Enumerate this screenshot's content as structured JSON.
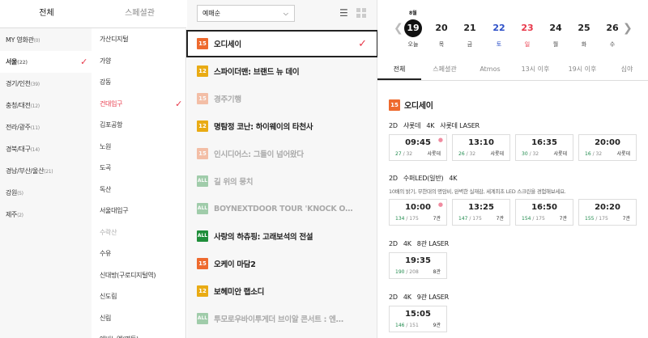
{
  "region_tabs": [
    "전체",
    "스페셜관"
  ],
  "regions": [
    {
      "name": "MY 영화관",
      "count": "(0)"
    },
    {
      "name": "서울",
      "count": "(22)"
    },
    {
      "name": "경기/인천",
      "count": "(39)"
    },
    {
      "name": "충청/대전",
      "count": "(12)"
    },
    {
      "name": "전라/광주",
      "count": "(11)"
    },
    {
      "name": "경북/대구",
      "count": "(14)"
    },
    {
      "name": "경남/부산/울산",
      "count": "(21)"
    },
    {
      "name": "강원",
      "count": "(5)"
    },
    {
      "name": "제주",
      "count": "(2)"
    }
  ],
  "theaters": [
    "가산디지털",
    "가양",
    "강동",
    "건대입구",
    "김포공항",
    "노원",
    "도곡",
    "독산",
    "서울대입구",
    "수락산",
    "수유",
    "신대방(구로디지털역)",
    "신도림",
    "신림",
    "에비뉴엘(명동)"
  ],
  "sort": {
    "label": "예매순",
    "arrow": "⌵"
  },
  "view_icons": {
    "list": "list-view-icon",
    "grid": "grid-view-icon"
  },
  "movies": [
    {
      "rating": "15",
      "title": "오디세이"
    },
    {
      "rating": "12",
      "title": "스파이더맨: 브랜드 뉴 데이"
    },
    {
      "rating": "15",
      "title": "경주기행"
    },
    {
      "rating": "12",
      "title": "명탐정 코난: 하이웨이의 타천사"
    },
    {
      "rating": "15",
      "title": "인시디어스: 그들이 넘어왔다"
    },
    {
      "rating": "ALL",
      "title": "길 위의 뭉치"
    },
    {
      "rating": "ALL",
      "title": "BOYNEXTDOOR TOUR 'KNOCK O…"
    },
    {
      "rating": "ALL",
      "title": "사랑의 하츄핑: 고래보석의 전설"
    },
    {
      "rating": "15",
      "title": "오케이 마담2"
    },
    {
      "rating": "12",
      "title": "보헤미안 랩소디"
    },
    {
      "rating": "ALL",
      "title": "투모로우바이투게더 브이알 콘서트 : 엔…"
    }
  ],
  "dates": {
    "month": "8월",
    "days": [
      {
        "num": "19",
        "wd": "오늘"
      },
      {
        "num": "20",
        "wd": "목"
      },
      {
        "num": "21",
        "wd": "금"
      },
      {
        "num": "22",
        "wd": "토"
      },
      {
        "num": "23",
        "wd": "일"
      },
      {
        "num": "24",
        "wd": "월"
      },
      {
        "num": "25",
        "wd": "화"
      },
      {
        "num": "26",
        "wd": "수"
      }
    ]
  },
  "format_tabs": [
    "전체",
    "스페셜관",
    "Atmos",
    "13시 이후",
    "19시 이후",
    "심야"
  ],
  "schedule": {
    "rating": "15",
    "title": "오디세이",
    "sections": [
      {
        "format": [
          "2D",
          "샤롯데",
          "4K",
          "샤롯데 LASER"
        ],
        "desc": "",
        "slots": [
          {
            "time": "09:45",
            "seats": "27",
            "total": "/ 32",
            "hall": "샤롯데",
            "dot": "●"
          },
          {
            "time": "13:10",
            "seats": "26",
            "total": "/ 32",
            "hall": "샤롯데",
            "dot": ""
          },
          {
            "time": "16:35",
            "seats": "30",
            "total": "/ 32",
            "hall": "샤롯데",
            "dot": ""
          },
          {
            "time": "20:00",
            "seats": "16",
            "total": "/ 32",
            "hall": "샤롯데",
            "dot": ""
          }
        ]
      },
      {
        "format": [
          "2D",
          "수퍼LED(일반)",
          "4K"
        ],
        "desc": "10배의 밝기, 무한대의 명암비, 완벽한 실재감, 세계최초 LED 스크린을 경험해보세요.",
        "slots": [
          {
            "time": "10:00",
            "seats": "134",
            "total": "/ 175",
            "hall": "7관",
            "dot": "●"
          },
          {
            "time": "13:25",
            "seats": "147",
            "total": "/ 175",
            "hall": "7관",
            "dot": ""
          },
          {
            "time": "16:50",
            "seats": "154",
            "total": "/ 175",
            "hall": "7관",
            "dot": ""
          },
          {
            "time": "20:20",
            "seats": "155",
            "total": "/ 175",
            "hall": "7관",
            "dot": ""
          }
        ]
      },
      {
        "format": [
          "2D",
          "4K",
          "8관 LASER"
        ],
        "desc": "",
        "slots": [
          {
            "time": "19:35",
            "seats": "190",
            "total": "/ 208",
            "hall": "8관",
            "dot": ""
          }
        ]
      },
      {
        "format": [
          "2D",
          "4K",
          "9관 LASER"
        ],
        "desc": "",
        "slots": [
          {
            "time": "15:05",
            "seats": "146",
            "total": "/ 151",
            "hall": "9관",
            "dot": ""
          }
        ]
      }
    ]
  },
  "check_mark": "✓",
  "colors": {
    "accent": "#e8384a",
    "rating15": "#ee6a2e",
    "rating12": "#e9ab14",
    "ratingAll": "#1f8e3a",
    "seats": "#1f8a4c"
  }
}
